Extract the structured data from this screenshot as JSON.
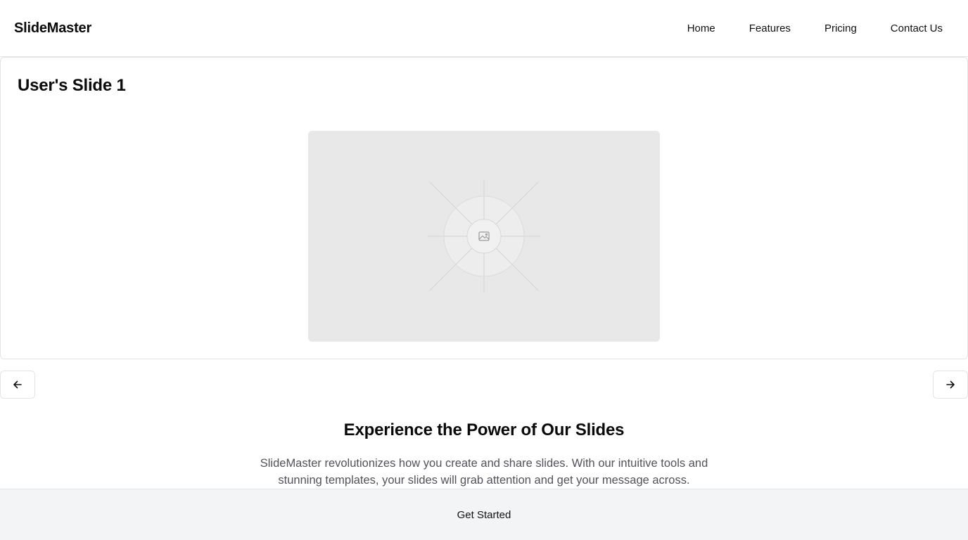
{
  "header": {
    "logo": "SlideMaster",
    "nav": [
      "Home",
      "Features",
      "Pricing",
      "Contact Us"
    ]
  },
  "slide": {
    "title": "User's Slide 1",
    "image_icon": "image-placeholder-icon"
  },
  "carousel": {
    "prev_icon": "arrow-left-icon",
    "next_icon": "arrow-right-icon"
  },
  "section": {
    "heading": "Experience the Power of Our Slides",
    "text": "SlideMaster revolutionizes how you create and share slides. With our intuitive tools and stunning templates, your slides will grab attention and get your message across."
  },
  "footer": {
    "cta_label": "Get Started"
  },
  "colors": {
    "border": "#e4e4e7",
    "placeholder_bg": "#e8e8e8",
    "muted_text": "#52525b",
    "footer_bg": "#f3f4f6"
  }
}
